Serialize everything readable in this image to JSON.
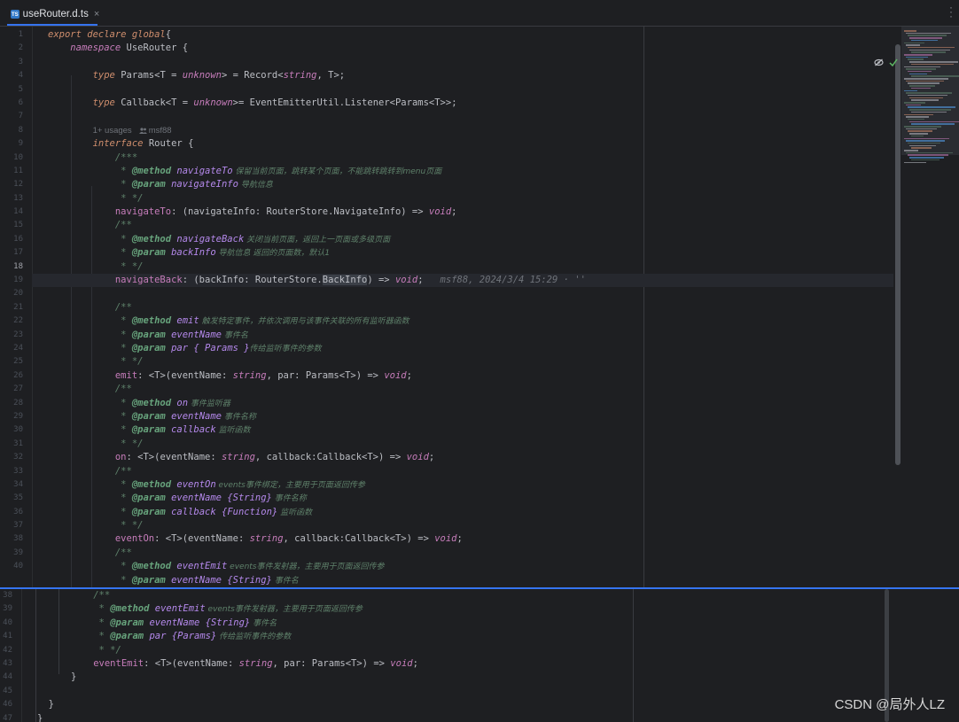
{
  "tab": {
    "file_name": "useRouter.d.ts",
    "close_glyph": "×",
    "icon": "typescript-file-icon"
  },
  "inlay": {
    "usages": "1+ usages",
    "author": "msf88"
  },
  "blame": "msf88, 2024/3/4 15:29 · ''",
  "top_pane": {
    "line_numbers": [
      "1",
      "2",
      "3",
      "4",
      "5",
      "6",
      "7",
      "8",
      "9",
      "10",
      "11",
      "12",
      "13",
      "14",
      "15",
      "16",
      "17",
      "18",
      "19",
      "20",
      "21",
      "22",
      "23",
      "24",
      "25",
      "26",
      "27",
      "28",
      "29",
      "30",
      "31",
      "32",
      "33",
      "34",
      "35",
      "36",
      "37",
      "38",
      "39",
      "40"
    ],
    "active_line": "18"
  },
  "bottom_pane": {
    "line_numbers": [
      "38",
      "39",
      "40",
      "41",
      "42",
      "43",
      "44",
      "45",
      "46",
      "47"
    ]
  },
  "code": {
    "l1": [
      "export declare global",
      "{"
    ],
    "l2": [
      "namespace",
      "UseRouter",
      "{"
    ],
    "l4": [
      "type",
      "Params",
      "<T = ",
      "unknown",
      "> = Record<",
      "string",
      ", T>;"
    ],
    "l6": [
      "type",
      "Callback",
      "<T = ",
      "unknown",
      ">= EventEmitterUtil.Listener<Params<T>>;"
    ],
    "l8": [
      "interface",
      "Router",
      "{"
    ],
    "l9": "/***",
    "l10": [
      " * ",
      "@method",
      " navigateTo",
      " 保留当前页面，跳转某个页面，不能跳转跳转到menu页面"
    ],
    "l11": [
      " * ",
      "@param",
      " navigateInfo",
      " 导航信息"
    ],
    "l12": " * */",
    "l13": [
      "navigateTo",
      ": (navigateInfo: RouterStore.NavigateInfo) => ",
      "void",
      ";"
    ],
    "l14": "/**",
    "l15": [
      " * ",
      "@method",
      " navigateBack",
      " 关闭当前页面，返回上一页面或多级页面"
    ],
    "l16": [
      " * ",
      "@param",
      " backInfo",
      " 导航信息 返回的页面数，默认1"
    ],
    "l17": " * */",
    "l18": [
      "navigateBack",
      ": (backInfo: RouterStore.",
      "BackInfo",
      ") => ",
      "void",
      ";"
    ],
    "l20": "/**",
    "l21": [
      " * ",
      "@method",
      " emit",
      " 触发特定事件，并依次调用与该事件关联的所有监听器函数"
    ],
    "l22": [
      " * ",
      "@param",
      " eventName",
      " 事件名"
    ],
    "l23": [
      " * ",
      "@param",
      " par",
      " { Params }",
      "传给监听事件的参数"
    ],
    "l24": " * */",
    "l25": [
      "emit",
      ": <T>(eventName: ",
      "string",
      ", par: Params<T>) => ",
      "void",
      ";"
    ],
    "l26": "/**",
    "l27": [
      " * ",
      "@method",
      " on",
      " 事件监听器"
    ],
    "l28": [
      " * ",
      "@param",
      " eventName",
      " 事件名称"
    ],
    "l29": [
      " * ",
      "@param",
      " callback",
      " 监听函数"
    ],
    "l30": " * */",
    "l31": [
      "on",
      ": <T>(eventName: ",
      "string",
      ", callback:Callback<T>) => ",
      "void",
      ";"
    ],
    "l32": "/**",
    "l33": [
      " * ",
      "@method",
      " eventOn",
      " events事件绑定，主要用于页面返回传参"
    ],
    "l34": [
      " * ",
      "@param",
      " eventName",
      " {String}",
      " 事件名称"
    ],
    "l35": [
      " * ",
      "@param",
      " callback",
      " {Function}",
      " 监听函数"
    ],
    "l36": " * */",
    "l37": [
      "eventOn",
      ": <T>(eventName: ",
      "string",
      ", callback:Callback<T>) => ",
      "void",
      ";"
    ],
    "l38": "/**",
    "l39": [
      " * ",
      "@method",
      " eventEmit",
      " events事件发射器，主要用于页面返回传参"
    ],
    "l40": [
      " * ",
      "@param",
      " eventName",
      " {String}",
      " 事件名"
    ],
    "b41": [
      " * ",
      "@param",
      " par",
      " {Params}",
      " 传给监听事件的参数"
    ],
    "b42": " * */",
    "b43": [
      "eventEmit",
      ": <T>(eventName: ",
      "string",
      ", par: Params<T>) => ",
      "void",
      ";"
    ],
    "b44": "}",
    "b46": "}",
    "b47": "}"
  },
  "watermark": "CSDN @局外人LZ",
  "colors": {
    "accent": "#3574f0",
    "editor_bg": "#1e1f22",
    "keyword": "#cf8e6d",
    "doc_comment": "#5f826b"
  }
}
